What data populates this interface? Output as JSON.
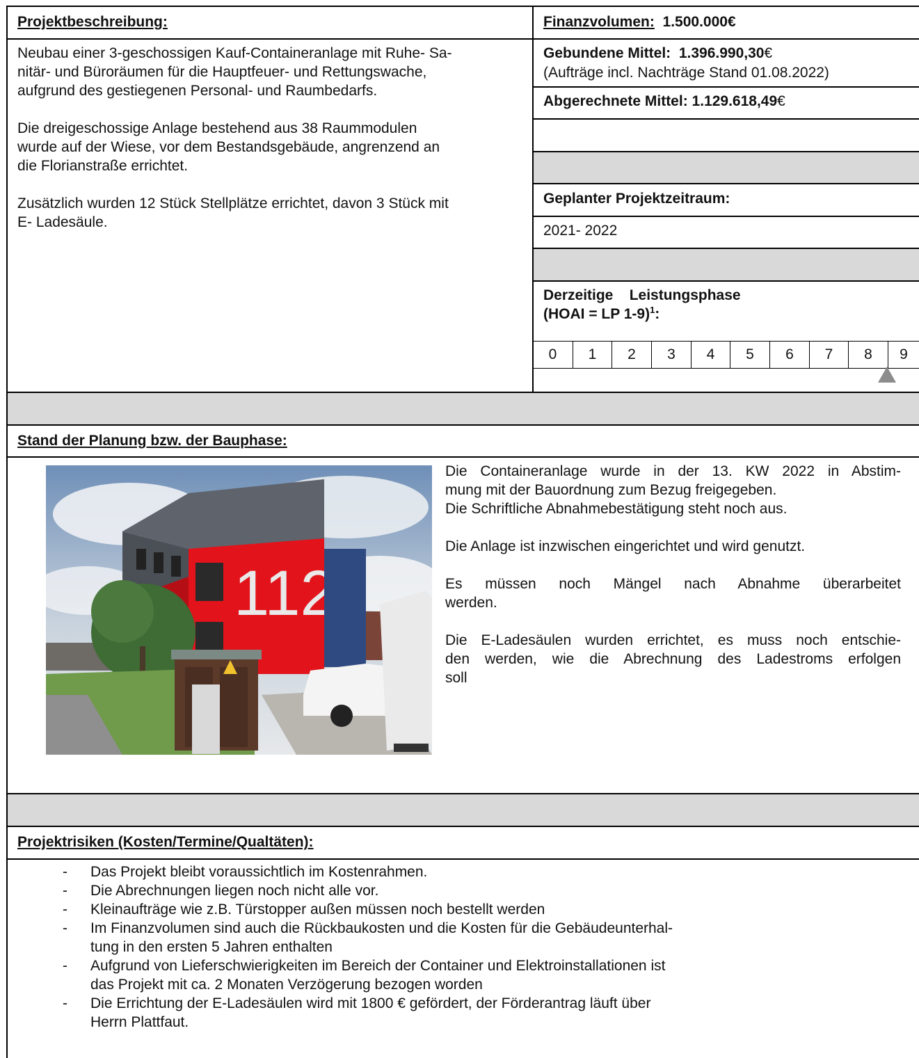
{
  "header": {
    "left_title": "Projektbeschreibung:",
    "fin_label": "Finanzvolumen:",
    "fin_value": "1.500.000€"
  },
  "description": {
    "p1_lines": [
      "Neubau einer 3-geschossigen Kauf-Containeranlage mit Ruhe- Sa-",
      "nitär- und Büroräumen für die Hauptfeuer- und Rettungswache,",
      "aufgrund des gestiegenen Personal- und Raumbedarfs."
    ],
    "p2_lines": [
      "Die dreigeschossige Anlage bestehend aus 38 Raummodulen",
      "wurde auf der Wiese, vor dem Bestandsgebäude, angrenzend an",
      "die Florianstraße errichtet."
    ],
    "p3_lines": [
      "Zusätzlich wurden 12 Stück Stellplätze errichtet, davon 3 Stück mit",
      "E- Ladesäule."
    ]
  },
  "finance": {
    "gebunden_label": "Gebundene Mittel:",
    "gebunden_value": "1.396.990,30",
    "euro": "€",
    "gebunden_note": "(Aufträge incl. Nachträge Stand 01.08.2022)",
    "abgerechnet_label": "Abgerechnete Mittel:",
    "abgerechnet_value": "1.129.618,49"
  },
  "schedule": {
    "label": "Geplanter Projektzeitraum:",
    "value": "2021- 2022"
  },
  "phase": {
    "label_line1_a": "Derzeitige",
    "label_line1_b": "Leistungsphase",
    "label_line2": "(HOAI = LP 1-9)",
    "footnote": "1",
    "colon": ":",
    "steps": [
      "0",
      "1",
      "2",
      "3",
      "4",
      "5",
      "6",
      "7",
      "8",
      "9"
    ],
    "current_marker_at": "8"
  },
  "status": {
    "title": "Stand der Planung bzw. der Bauphase:",
    "photo_text": "112",
    "p1_lines": [
      "Die Containeranlage wurde in der 13. KW 2022 in Abstim-",
      "mung mit der Bauordnung zum Bezug freigegeben.",
      "Die Schriftliche Abnahmebestätigung steht noch aus."
    ],
    "p2": "Die Anlage ist inzwischen eingerichtet und wird genutzt.",
    "p3_lines": [
      "Es müssen noch Mängel nach Abnahme überarbeitet",
      "werden."
    ],
    "p4_lines": [
      "Die E-Ladesäulen wurden errichtet, es muss noch entschie-",
      "den werden, wie die Abrechnung des Ladestroms erfolgen",
      "soll"
    ]
  },
  "risks": {
    "title": "Projektrisiken (Kosten/Termine/Qualtäten):",
    "items": [
      {
        "dash": "-",
        "lines": [
          "Das Projekt bleibt voraussichtlich im Kostenrahmen."
        ]
      },
      {
        "dash": "-",
        "lines": [
          "Die Abrechnungen liegen noch nicht alle vor."
        ]
      },
      {
        "dash": "-",
        "lines": [
          "Kleinaufträge wie z.B. Türstopper außen müssen noch bestellt werden"
        ]
      },
      {
        "dash": "-",
        "lines": [
          "Im Finanzvolumen sind auch die Rückbaukosten und die Kosten für die Gebäudeunterhal-",
          "tung in den ersten 5 Jahren enthalten"
        ]
      },
      {
        "dash": "-",
        "lines": [
          "Aufgrund von Lieferschwierigkeiten im Bereich der Container und Elektroinstallationen ist",
          "das Projekt mit ca. 2 Monaten Verzögerung bezogen worden"
        ]
      },
      {
        "dash": "-",
        "lines": [
          "Die Errichtung der E-Ladesäulen wird mit 1800 € gefördert, der Förderantrag läuft über",
          "Herrn Plattfaut."
        ]
      }
    ]
  }
}
